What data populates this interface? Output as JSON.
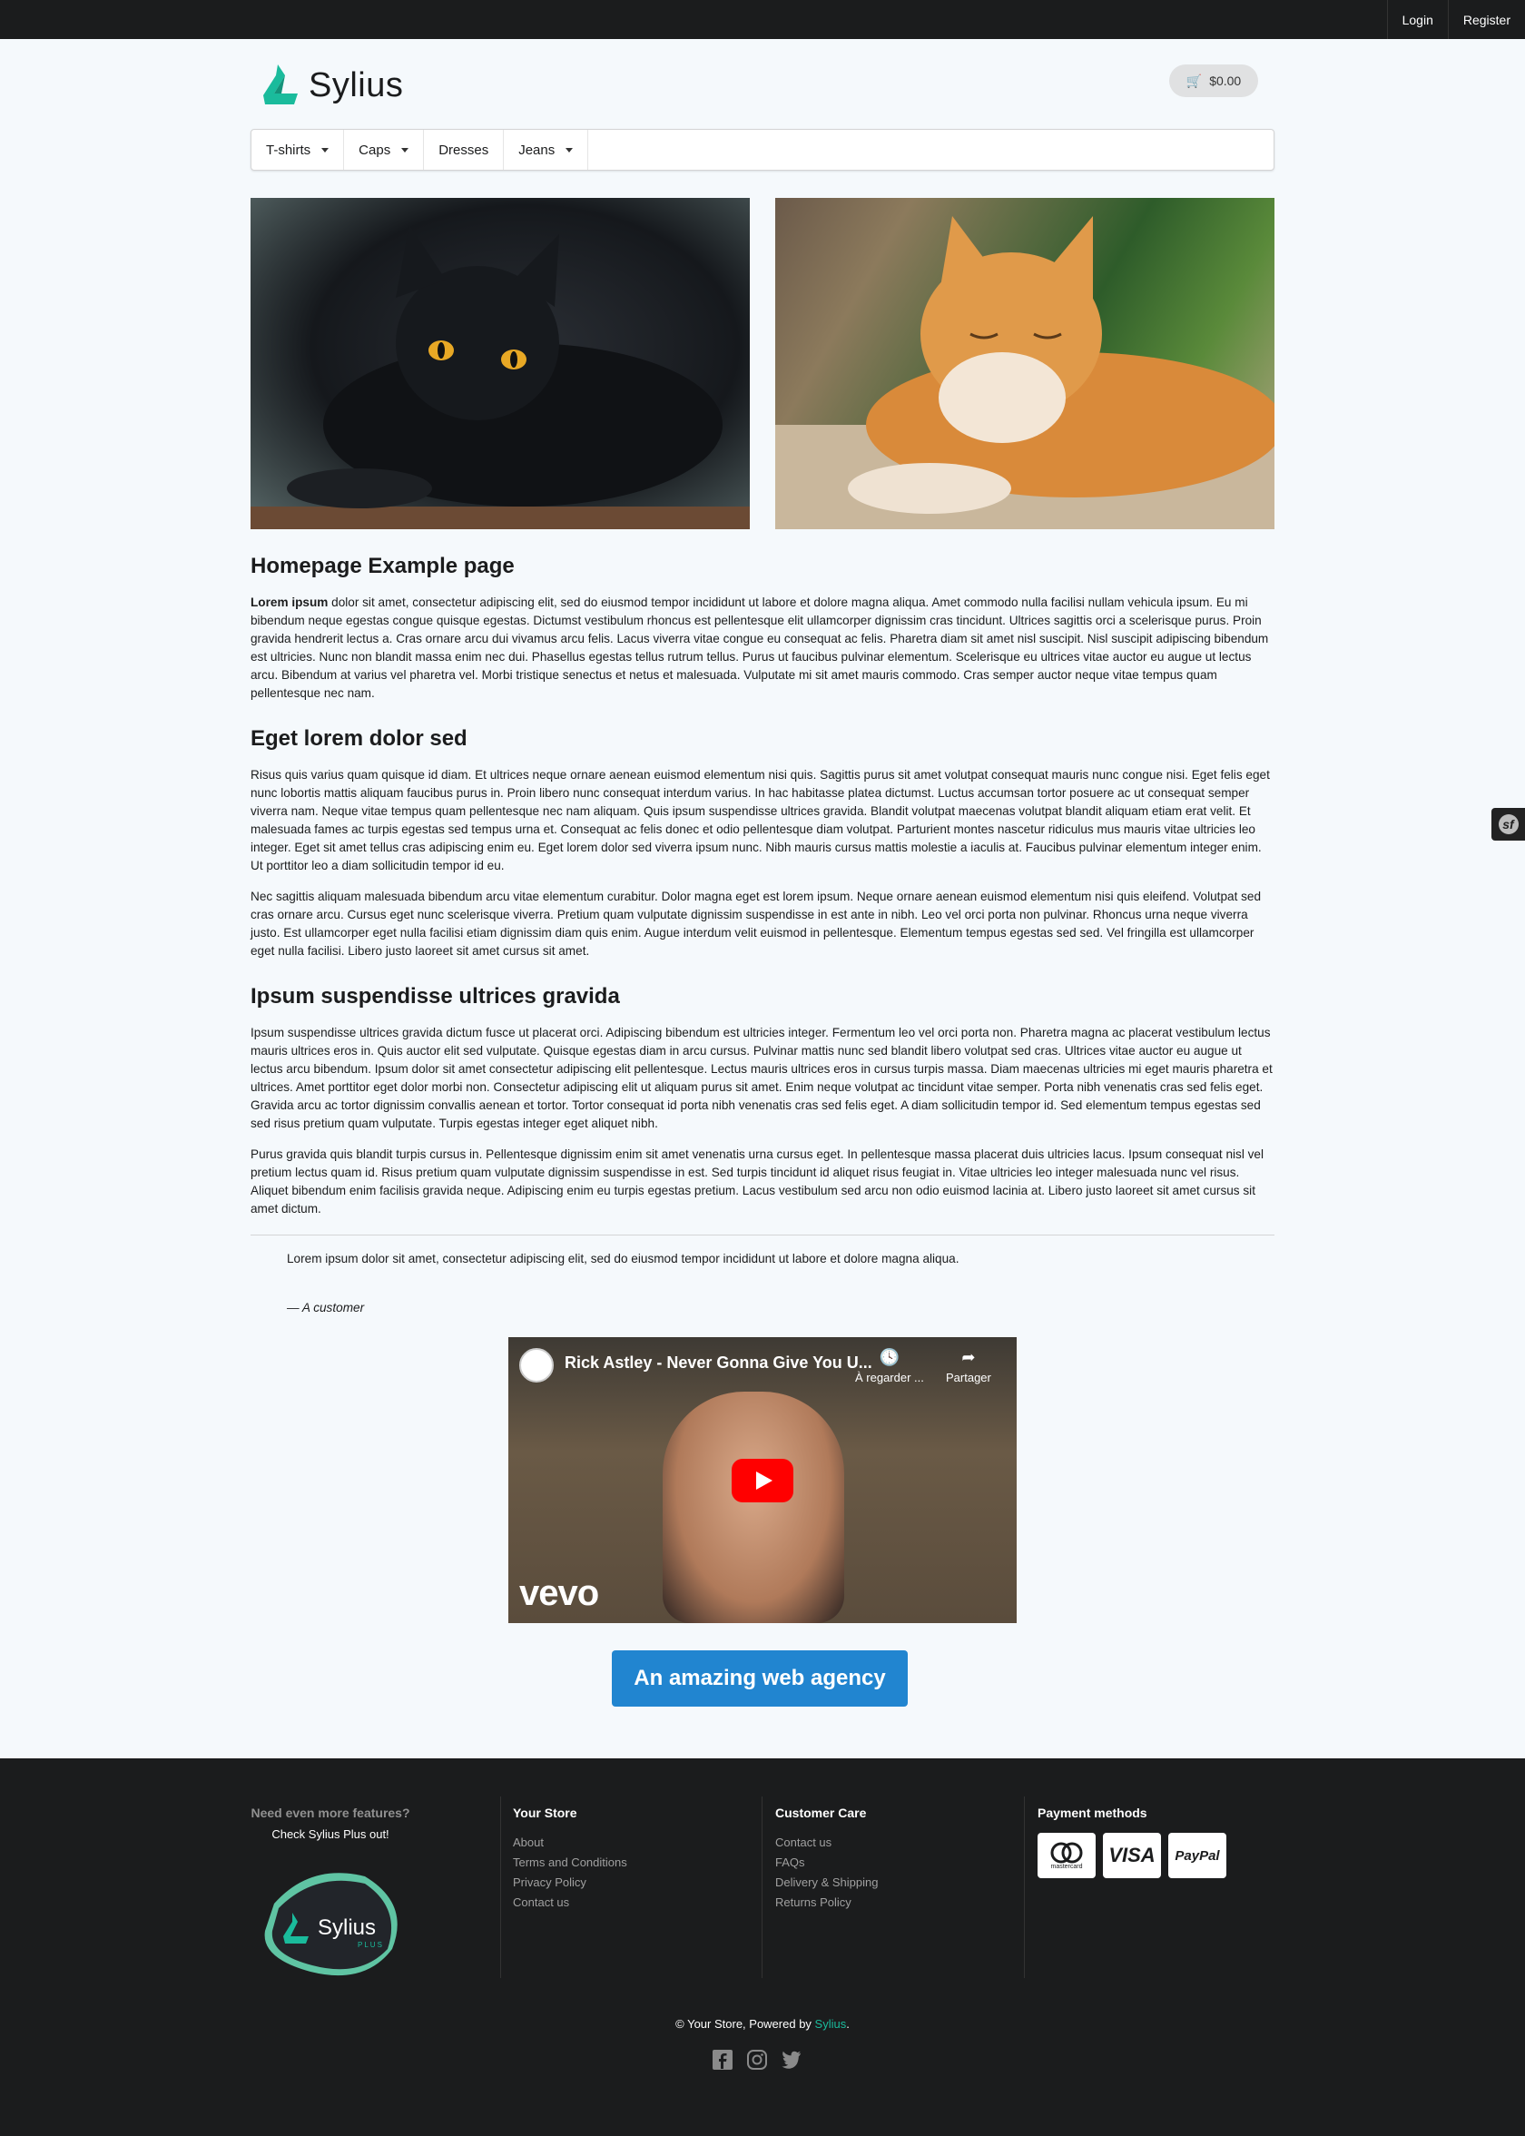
{
  "topbar": {
    "login": "Login",
    "register": "Register"
  },
  "header": {
    "brand": "Sylius",
    "cart_total": "$0.00"
  },
  "menu": {
    "items": [
      {
        "label": "T-shirts",
        "dropdown": true
      },
      {
        "label": "Caps",
        "dropdown": true
      },
      {
        "label": "Dresses",
        "dropdown": false
      },
      {
        "label": "Jeans",
        "dropdown": true
      }
    ]
  },
  "page": {
    "title": "Homepage Example page",
    "intro_bold": "Lorem ipsum",
    "intro_rest": " dolor sit amet, consectetur adipiscing elit, sed do eiusmod tempor incididunt ut labore et dolore magna aliqua. Amet commodo nulla facilisi nullam vehicula ipsum. Eu mi bibendum neque egestas congue quisque egestas. Dictumst vestibulum rhoncus est pellentesque elit ullamcorper dignissim cras tincidunt. Ultrices sagittis orci a scelerisque purus. Proin gravida hendrerit lectus a. Cras ornare arcu dui vivamus arcu felis. Lacus viverra vitae congue eu consequat ac felis. Pharetra diam sit amet nisl suscipit. Nisl suscipit adipiscing bibendum est ultricies. Nunc non blandit massa enim nec dui. Phasellus egestas tellus rutrum tellus. Purus ut faucibus pulvinar elementum. Scelerisque eu ultrices vitae auctor eu augue ut lectus arcu. Bibendum at varius vel pharetra vel. Morbi tristique senectus et netus et malesuada. Vulputate mi sit amet mauris commodo. Cras semper auctor neque vitae tempus quam pellentesque nec nam.",
    "section2_title": "Eget lorem dolor sed",
    "section2_p1": "Risus quis varius quam quisque id diam. Et ultrices neque ornare aenean euismod elementum nisi quis. Sagittis purus sit amet volutpat consequat mauris nunc congue nisi. Eget felis eget nunc lobortis mattis aliquam faucibus purus in. Proin libero nunc consequat interdum varius. In hac habitasse platea dictumst. Luctus accumsan tortor posuere ac ut consequat semper viverra nam. Neque vitae tempus quam pellentesque nec nam aliquam. Quis ipsum suspendisse ultrices gravida. Blandit volutpat maecenas volutpat blandit aliquam etiam erat velit. Et malesuada fames ac turpis egestas sed tempus urna et. Consequat ac felis donec et odio pellentesque diam volutpat. Parturient montes nascetur ridiculus mus mauris vitae ultricies leo integer. Eget sit amet tellus cras adipiscing enim eu. Eget lorem dolor sed viverra ipsum nunc. Nibh mauris cursus mattis molestie a iaculis at. Faucibus pulvinar elementum integer enim. Ut porttitor leo a diam sollicitudin tempor id eu.",
    "section2_p2": "Nec sagittis aliquam malesuada bibendum arcu vitae elementum curabitur. Dolor magna eget est lorem ipsum. Neque ornare aenean euismod elementum nisi quis eleifend. Volutpat sed cras ornare arcu. Cursus eget nunc scelerisque viverra. Pretium quam vulputate dignissim suspendisse in est ante in nibh. Leo vel orci porta non pulvinar. Rhoncus urna neque viverra justo. Est ullamcorper eget nulla facilisi etiam dignissim diam quis enim. Augue interdum velit euismod in pellentesque. Elementum tempus egestas sed sed. Vel fringilla est ullamcorper eget nulla facilisi. Libero justo laoreet sit amet cursus sit amet.",
    "section3_title": "Ipsum suspendisse ultrices gravida",
    "section3_p1": "Ipsum suspendisse ultrices gravida dictum fusce ut placerat orci. Adipiscing bibendum est ultricies integer. Fermentum leo vel orci porta non. Pharetra magna ac placerat vestibulum lectus mauris ultrices eros in. Quis auctor elit sed vulputate. Quisque egestas diam in arcu cursus. Pulvinar mattis nunc sed blandit libero volutpat sed cras. Ultrices vitae auctor eu augue ut lectus arcu bibendum. Ipsum dolor sit amet consectetur adipiscing elit pellentesque. Lectus mauris ultrices eros in cursus turpis massa. Diam maecenas ultricies mi eget mauris pharetra et ultrices. Amet porttitor eget dolor morbi non. Consectetur adipiscing elit ut aliquam purus sit amet. Enim neque volutpat ac tincidunt vitae semper. Porta nibh venenatis cras sed felis eget. Gravida arcu ac tortor dignissim convallis aenean et tortor. Tortor consequat id porta nibh venenatis cras sed felis eget. A diam sollicitudin tempor id. Sed elementum tempus egestas sed sed risus pretium quam vulputate. Turpis egestas integer eget aliquet nibh.",
    "section3_p2": "Purus gravida quis blandit turpis cursus in. Pellentesque dignissim enim sit amet venenatis urna cursus eget. In pellentesque massa placerat duis ultricies lacus. Ipsum consequat nisl vel pretium lectus quam id. Risus pretium quam vulputate dignissim suspendisse in est. Sed turpis tincidunt id aliquet risus feugiat in. Vitae ultricies leo integer malesuada nunc vel risus. Aliquet bibendum enim facilisis gravida neque. Adipiscing enim eu turpis egestas pretium. Lacus vestibulum sed arcu non odio euismod lacinia at. Libero justo laoreet sit amet cursus sit amet dictum.",
    "quote_text": "Lorem ipsum dolor sit amet, consectetur adipiscing elit, sed do eiusmod tempor incididunt ut labore et dolore magna aliqua.",
    "quote_author": "— A customer"
  },
  "video": {
    "title": "Rick Astley - Never Gonna Give You U...",
    "watch_later": "À regarder ...",
    "share": "Partager",
    "watermark": "vevo"
  },
  "cta": {
    "label": "An amazing web agency"
  },
  "footer": {
    "plus_question": "Need even more features?",
    "plus_check": "Check Sylius Plus out!",
    "plus_logo_text": "Sylius",
    "plus_logo_sub": "PLUS",
    "your_store_title": "Your Store",
    "your_store_links": [
      "About",
      "Terms and Conditions",
      "Privacy Policy",
      "Contact us"
    ],
    "customer_care_title": "Customer Care",
    "customer_care_links": [
      "Contact us",
      "FAQs",
      "Delivery & Shipping",
      "Returns Policy"
    ],
    "payment_title": "Payment methods",
    "payment_methods": [
      "mastercard",
      "VISA",
      "PayPal"
    ],
    "copyright_prefix": "© Your Store, Powered by ",
    "copyright_brand": "Sylius",
    "copyright_suffix": "."
  },
  "colors": {
    "accent": "#2185d0",
    "brand": "#1abb9c",
    "dark": "#1b1c1d"
  }
}
